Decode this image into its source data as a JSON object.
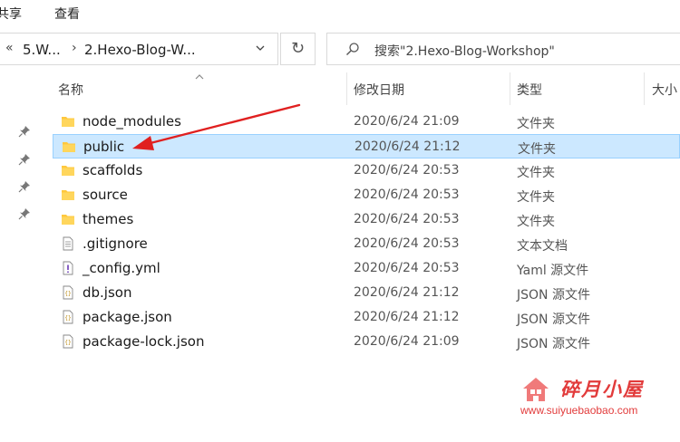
{
  "ribbon": {
    "share_label": "共享",
    "view_label": "查看"
  },
  "address": {
    "crumbs": [
      "5.W...",
      "2.Hexo-Blog-W..."
    ],
    "back_glyph": "«",
    "separator_glyph": "›",
    "refresh_glyph": "↻"
  },
  "search": {
    "placeholder": "搜索\"2.Hexo-Blog-Workshop\""
  },
  "columns": {
    "name": "名称",
    "date": "修改日期",
    "type": "类型",
    "size": "大小"
  },
  "files": [
    {
      "name": "node_modules",
      "date": "2020/6/24 21:09",
      "type": "文件夹",
      "icon": "folder-icon"
    },
    {
      "name": "public",
      "date": "2020/6/24 21:12",
      "type": "文件夹",
      "icon": "folder-icon",
      "selected": true
    },
    {
      "name": "scaffolds",
      "date": "2020/6/24 20:53",
      "type": "文件夹",
      "icon": "folder-icon"
    },
    {
      "name": "source",
      "date": "2020/6/24 20:53",
      "type": "文件夹",
      "icon": "folder-icon"
    },
    {
      "name": "themes",
      "date": "2020/6/24 20:53",
      "type": "文件夹",
      "icon": "folder-icon"
    },
    {
      "name": ".gitignore",
      "date": "2020/6/24 20:53",
      "type": "文本文档",
      "icon": "text-file-icon"
    },
    {
      "name": "_config.yml",
      "date": "2020/6/24 20:53",
      "type": "Yaml 源文件",
      "icon": "yaml-file-icon"
    },
    {
      "name": "db.json",
      "date": "2020/6/24 21:12",
      "type": "JSON 源文件",
      "icon": "json-file-icon"
    },
    {
      "name": "package.json",
      "date": "2020/6/24 21:12",
      "type": "JSON 源文件",
      "icon": "json-file-icon"
    },
    {
      "name": "package-lock.json",
      "date": "2020/6/24 21:09",
      "type": "JSON 源文件",
      "icon": "json-file-icon"
    }
  ],
  "watermark": {
    "title": "碎月小屋",
    "url": "www.suiyuebaobao.com"
  },
  "colors": {
    "selection": "#cce8ff",
    "selection_border": "#99d1ff",
    "folder": "#ffc83d",
    "annotation": "#e02020"
  }
}
